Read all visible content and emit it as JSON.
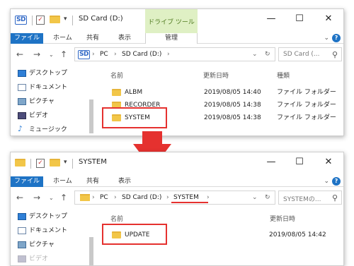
{
  "window1": {
    "title": "SD Card (D:)",
    "tool_tab": "ドライブ ツール",
    "ribbon_tabs": [
      "ファイル",
      "ホーム",
      "共有",
      "表示",
      "管理"
    ],
    "breadcrumb": [
      "PC",
      "SD Card (D:)"
    ],
    "search_placeholder": "SD Card (...",
    "nav_items": [
      "デスクトップ",
      "ドキュメント",
      "ピクチャ",
      "ビデオ",
      "ミュージック"
    ],
    "columns": {
      "name": "名前",
      "date": "更新日時",
      "type": "種類"
    },
    "rows": [
      {
        "name": "ALBM",
        "date": "2019/08/05 14:40",
        "type": "ファイル フォルダー"
      },
      {
        "name": "RECORDER",
        "date": "2019/08/05 14:38",
        "type": "ファイル フォルダー"
      },
      {
        "name": "SYSTEM",
        "date": "2019/08/05 14:38",
        "type": "ファイル フォルダー"
      }
    ]
  },
  "window2": {
    "title": "SYSTEM",
    "ribbon_tabs": [
      "ファイル",
      "ホーム",
      "共有",
      "表示"
    ],
    "breadcrumb": [
      "PC",
      "SD Card (D:)",
      "SYSTEM"
    ],
    "search_placeholder": "SYSTEMの...",
    "nav_items": [
      "デスクトップ",
      "ドキュメント",
      "ピクチャ",
      "ビデオ"
    ],
    "columns": {
      "name": "名前",
      "date": "更新日時"
    },
    "rows": [
      {
        "name": "UPDATE",
        "date": "2019/08/05 14:42"
      }
    ]
  },
  "controls": {
    "minimize": "—",
    "maximize": "☐",
    "close": "✕",
    "help": "?"
  },
  "colors": {
    "accent": "#1e73c5",
    "highlight": "#e5312f",
    "folder": "#f2c648",
    "tool_tab": "#dff0c4"
  }
}
